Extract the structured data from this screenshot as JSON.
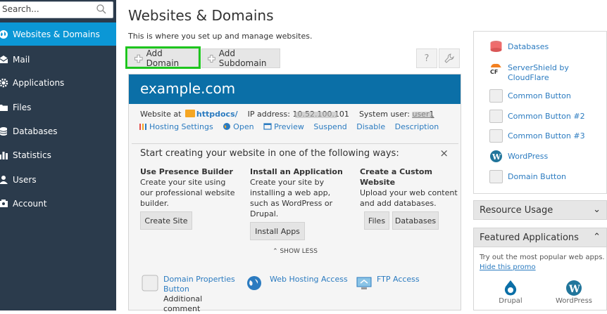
{
  "sidebar": {
    "search_placeholder": "Search...",
    "items": [
      {
        "label": "Websites & Domains",
        "icon": "globe-icon",
        "active": true
      },
      {
        "label": "Mail",
        "icon": "mail-icon"
      },
      {
        "label": "Applications",
        "icon": "gear-icon"
      },
      {
        "label": "Files",
        "icon": "folder-icon"
      },
      {
        "label": "Databases",
        "icon": "database-icon"
      },
      {
        "label": "Statistics",
        "icon": "bar-chart-icon"
      },
      {
        "label": "Users",
        "icon": "user-icon"
      },
      {
        "label": "Account",
        "icon": "account-icon"
      }
    ]
  },
  "main": {
    "title": "Websites & Domains",
    "description": "This is where you set up and manage websites.",
    "add_domain": "Add Domain",
    "add_subdomain": "Add Subdomain",
    "help_icon": "?",
    "site": {
      "name": "example.com",
      "website_at_label": "Website at",
      "docroot": "httpdocs/",
      "ip_label": "IP address:",
      "ip_value": "10.52.100.101",
      "system_user_label": "System user:",
      "system_user": "user1",
      "links": [
        "Hosting Settings",
        "Open",
        "Preview",
        "Suspend",
        "Disable",
        "Description"
      ]
    },
    "start": {
      "title": "Start creating your website in one of the following ways:",
      "close": "×",
      "columns": [
        {
          "title": "Use Presence Builder",
          "text": [
            "Create your site using",
            "our professional website",
            "builder."
          ],
          "buttons": [
            "Create Site"
          ]
        },
        {
          "title": "Install an Application",
          "text": [
            "Create your site by",
            "installing a web app,",
            "such as WordPress or",
            "Drupal."
          ],
          "buttons": [
            "Install Apps"
          ]
        },
        {
          "title": "Create a Custom",
          "title2": "Website",
          "text": [
            "Upload your web content",
            "and add databases."
          ],
          "buttons": [
            "Files",
            "Databases"
          ]
        }
      ],
      "show_less": "SHOW LESS"
    },
    "tools": [
      {
        "label": "Domain Properties",
        "label2": "Button",
        "comment": "Additional comment"
      },
      {
        "label": "Web Hosting Access"
      },
      {
        "label": "FTP Access"
      }
    ]
  },
  "right": {
    "items": [
      {
        "label": "Databases",
        "icon": "database-icon"
      },
      {
        "label": "ServerShield by",
        "label2": "CloudFlare",
        "icon": "cloudflare-icon"
      },
      {
        "label": "Common Button",
        "icon": "blank-icon"
      },
      {
        "label": "Common Button #2",
        "icon": "blank-icon"
      },
      {
        "label": "Common Button #3",
        "icon": "blank-icon"
      },
      {
        "label": "WordPress",
        "icon": "wordpress-icon"
      },
      {
        "label": "Domain Button",
        "icon": "blank-icon"
      }
    ],
    "resource_usage": "Resource Usage",
    "featured_title": "Featured Applications",
    "featured_text": "Try out the most popular web apps.",
    "featured_hide": "Hide this promo",
    "apps": [
      "Drupal",
      "WordPress"
    ]
  }
}
